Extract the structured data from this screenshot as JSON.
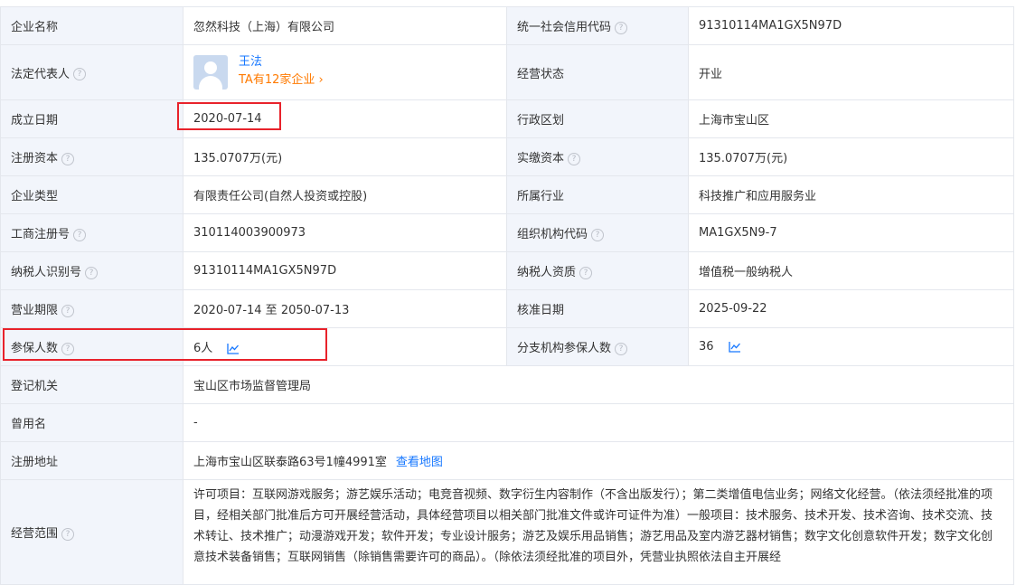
{
  "rows": [
    {
      "l1": "企业名称",
      "v1": "忽然科技（上海）有限公司",
      "l2": "统一社会信用代码",
      "v2": "91310114MA1GX5N97D"
    },
    {
      "l1": "法定代表人",
      "person": {
        "name": "王法",
        "count": "TA有12家企业"
      },
      "l2": "经营状态",
      "v2": "开业"
    },
    {
      "l1": "成立日期",
      "v1": "2020-07-14",
      "l2": "行政区划",
      "v2": "上海市宝山区"
    },
    {
      "l1": "注册资本",
      "v1": "135.0707万(元)",
      "l2": "实缴资本",
      "v2": "135.0707万(元)"
    },
    {
      "l1": "企业类型",
      "v1": "有限责任公司(自然人投资或控股)",
      "l2": "所属行业",
      "v2": "科技推广和应用服务业"
    },
    {
      "l1": "工商注册号",
      "v1": "310114003900973",
      "l2": "组织机构代码",
      "v2": "MA1GX5N9-7"
    },
    {
      "l1": "纳税人识别号",
      "v1": "91310114MA1GX5N97D",
      "l2": "纳税人资质",
      "v2": "增值税一般纳税人"
    },
    {
      "l1": "营业期限",
      "v1": "2020-07-14 至 2050-07-13",
      "l2": "核准日期",
      "v2": "2025-09-22"
    },
    {
      "l1": "参保人数",
      "v1": "6人",
      "l2": "分支机构参保人数",
      "v2": "36"
    },
    {
      "l1": "登记机关",
      "v1": "宝山区市场监督管理局"
    },
    {
      "l1": "曾用名",
      "v1": "-"
    },
    {
      "l1": "注册地址",
      "v1": "上海市宝山区联泰路63号1幢4991室",
      "link": "查看地图"
    },
    {
      "l1": "经营范围",
      "v1": "许可项目：互联网游戏服务；游艺娱乐活动；电竞音视频、数字衍生内容制作（不含出版发行）；第二类增值电信业务；网络文化经营。（依法须经批准的项目，经相关部门批准后方可开展经营活动，具体经营项目以相关部门批准文件或许可证件为准）一般项目：技术服务、技术开发、技术咨询、技术交流、技术转让、技术推广；动漫游戏开发；软件开发；专业设计服务；游艺及娱乐用品销售；游艺用品及室内游艺器材销售；数字文化创意软件开发；数字文化创意技术装备销售；互联网销售（除销售需要许可的商品）。（除依法须经批准的项目外，凭营业执照依法自主开展经"
    }
  ]
}
